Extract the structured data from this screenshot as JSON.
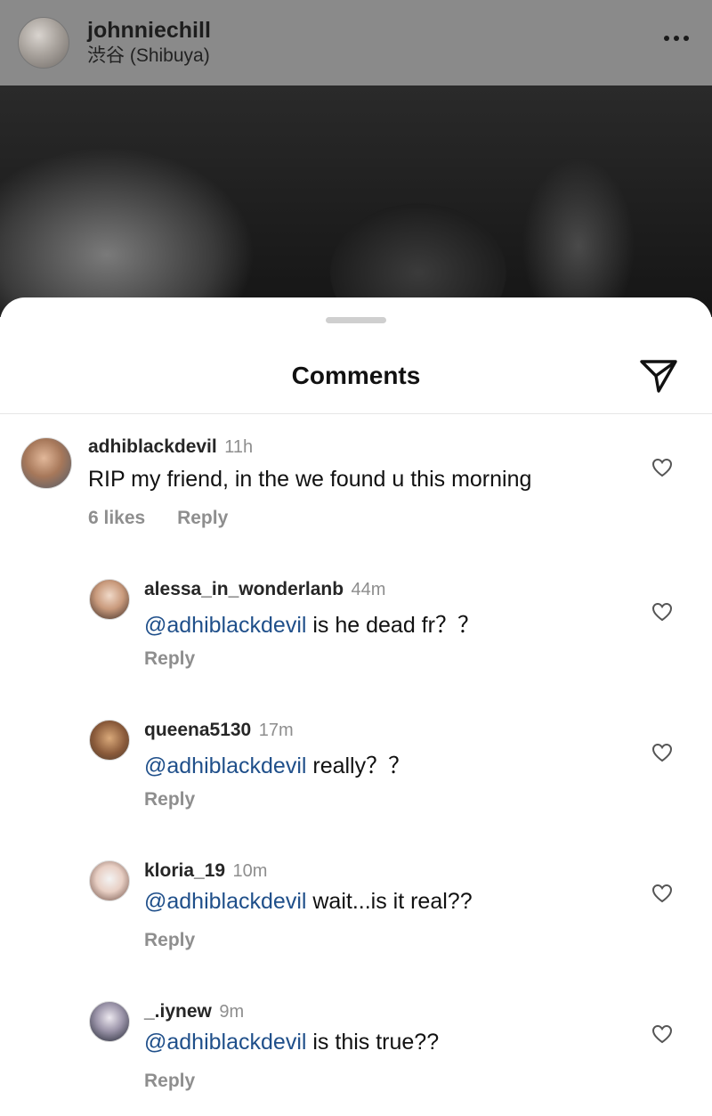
{
  "post": {
    "username": "johnniechill",
    "location": "渋谷 (Shibuya)"
  },
  "sheet": {
    "title": "Comments"
  },
  "comments": [
    {
      "username": "adhiblackdevil",
      "time": "11h",
      "mention": "",
      "text": "RIP my friend, in the we found u this morning",
      "likes": "6 likes",
      "reply": "Reply"
    }
  ],
  "replies": [
    {
      "username": "alessa_in_wonderlanb",
      "time": "44m",
      "mention": "@adhiblackdevil",
      "text": " is he dead fr？？",
      "reply": "Reply"
    },
    {
      "username": "queena5130",
      "time": "17m",
      "mention": "@adhiblackdevil",
      "text": " really？？",
      "reply": "Reply"
    },
    {
      "username": "kloria_19",
      "time": "10m",
      "mention": "@adhiblackdevil",
      "text": " wait...is it real??",
      "reply": "Reply"
    },
    {
      "username": "_.iynew",
      "time": "9m",
      "mention": "@adhiblackdevil",
      "text": " is this true??",
      "reply": "Reply"
    }
  ],
  "colors": {
    "mention": "#1f4f8a",
    "secondary_text": "#8e8e8e",
    "dim_overlay": "#8a8a8a"
  }
}
